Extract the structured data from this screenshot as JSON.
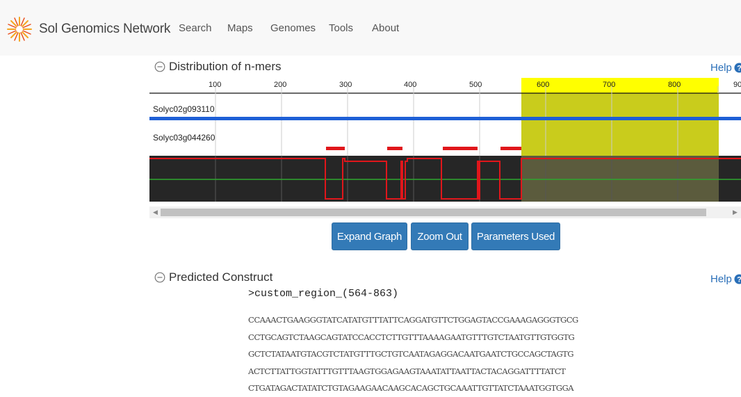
{
  "navbar": {
    "brand": "Sol Genomics Network",
    "items": [
      "Search",
      "Maps",
      "Genomes",
      "Tools",
      "About"
    ]
  },
  "distribution": {
    "title": "Distribution of n-mers",
    "help": "Help",
    "axis_ticks": [
      "100",
      "200",
      "300",
      "400",
      "500",
      "600",
      "700",
      "800",
      "90"
    ],
    "tracks": [
      "Solyc02g093110",
      "Solyc03g044260"
    ],
    "highlight_color": "#ffff00"
  },
  "buttons": {
    "expand": "Expand Graph",
    "zoom_out": "Zoom Out",
    "parameters": "Parameters Used"
  },
  "construct": {
    "title": "Predicted Construct",
    "help": "Help",
    "header": ">custom_region_(564-863)",
    "lines": [
      "CCAAACTGAAGGGTATCATATGTTTATTCAGGATGTTCTGGAGTACCGAAAGAGGGTGCG",
      "CCTGCAGTCTAAGCAGTATCCACCTCTTGTTTAAAAGAATGTTTGTCTAATGTTGTGGTG",
      "GCTCTATAATGTACGTCTATGTTTGCTGTCAATAGAGGACAATGAATCTGCCAGCTAGTG",
      "ACTCTTATTGGTATTTGTTTAAGTGGAGAAGTAAATATTAATTACTACAGGATTTTATCT",
      "CTGATAGACTATATCTGTAGAAGAACAAGCACAGCTGCAAATTGTTATCTAAATGGTGGA"
    ]
  }
}
